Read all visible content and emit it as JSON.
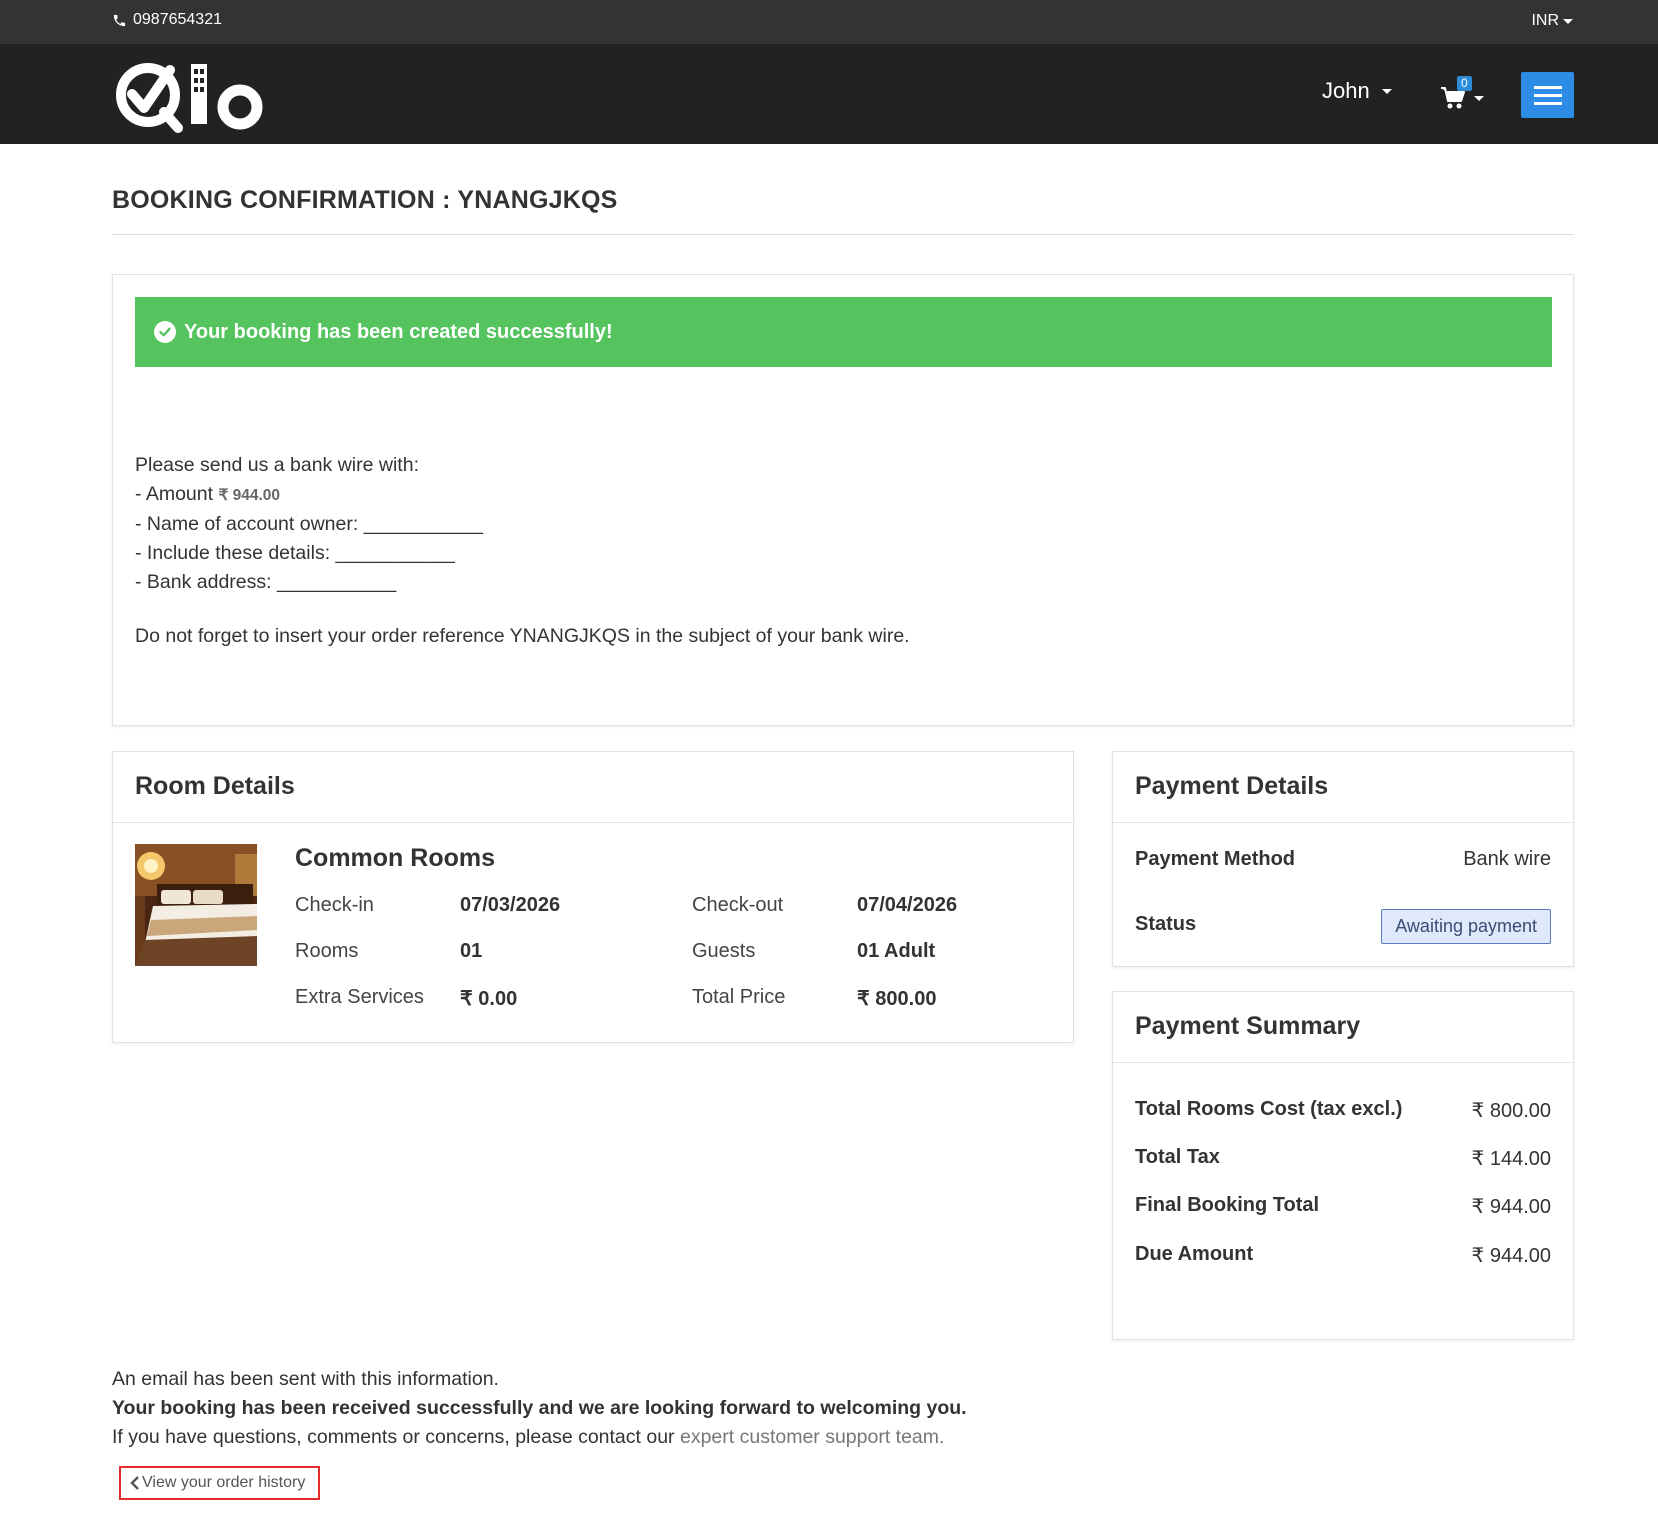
{
  "topbar": {
    "phone": "0987654321",
    "currency": "INR"
  },
  "navbar": {
    "user": "John",
    "cart_count": "0"
  },
  "page": {
    "title": "BOOKING CONFIRMATION : YNANGJKQS"
  },
  "confirmation": {
    "success_message": "Your booking has been created successfully!",
    "wire_intro": "Please send us a bank wire with:",
    "amount_label": "- Amount",
    "amount_value": "₹ 944.00",
    "owner_line": "- Name of account owner: ___________",
    "details_line": "- Include these details: ___________",
    "bank_line": "- Bank address: ___________",
    "reference_note": "Do not forget to insert your order reference YNANGJKQS in the subject of your bank wire."
  },
  "room_details": {
    "heading": "Room Details",
    "room_name": "Common Rooms",
    "checkin_label": "Check-in",
    "checkin_value": "07/03/2026",
    "checkout_label": "Check-out",
    "checkout_value": "07/04/2026",
    "rooms_label": "Rooms",
    "rooms_value": "01",
    "guests_label": "Guests",
    "guests_value": "01 Adult",
    "extra_label": "Extra Services",
    "extra_value": "₹ 0.00",
    "total_label": "Total Price",
    "total_value": "₹ 800.00"
  },
  "payment_details": {
    "heading": "Payment Details",
    "method_label": "Payment Method",
    "method_value": "Bank wire",
    "status_label": "Status",
    "status_value": "Awaiting payment"
  },
  "payment_summary": {
    "heading": "Payment Summary",
    "rows": [
      {
        "label": "Total Rooms Cost (tax excl.)",
        "value": "₹ 800.00"
      },
      {
        "label": "Total Tax",
        "value": "₹ 144.00"
      },
      {
        "label": "Final Booking Total",
        "value": "₹ 944.00"
      },
      {
        "label": "Due Amount",
        "value": "₹ 944.00"
      }
    ]
  },
  "footer": {
    "email_note": "An email has been sent with this information.",
    "received_note": "Your booking has been received successfully and we are looking forward to welcoming you.",
    "questions_note": "If you have questions, comments or concerns, please contact our",
    "support_link": "expert customer support team.",
    "history_button": "View your order history"
  },
  "colors": {
    "topbar": "#333333",
    "navbar": "#222222",
    "success": "#55c45e",
    "menu_button": "#2d8ce6",
    "history_border": "#e52b2b"
  },
  "icons": [
    "phone-icon",
    "caret-down-icon",
    "cart-icon",
    "hamburger-icon",
    "check-circle-icon",
    "chevron-left-icon"
  ]
}
